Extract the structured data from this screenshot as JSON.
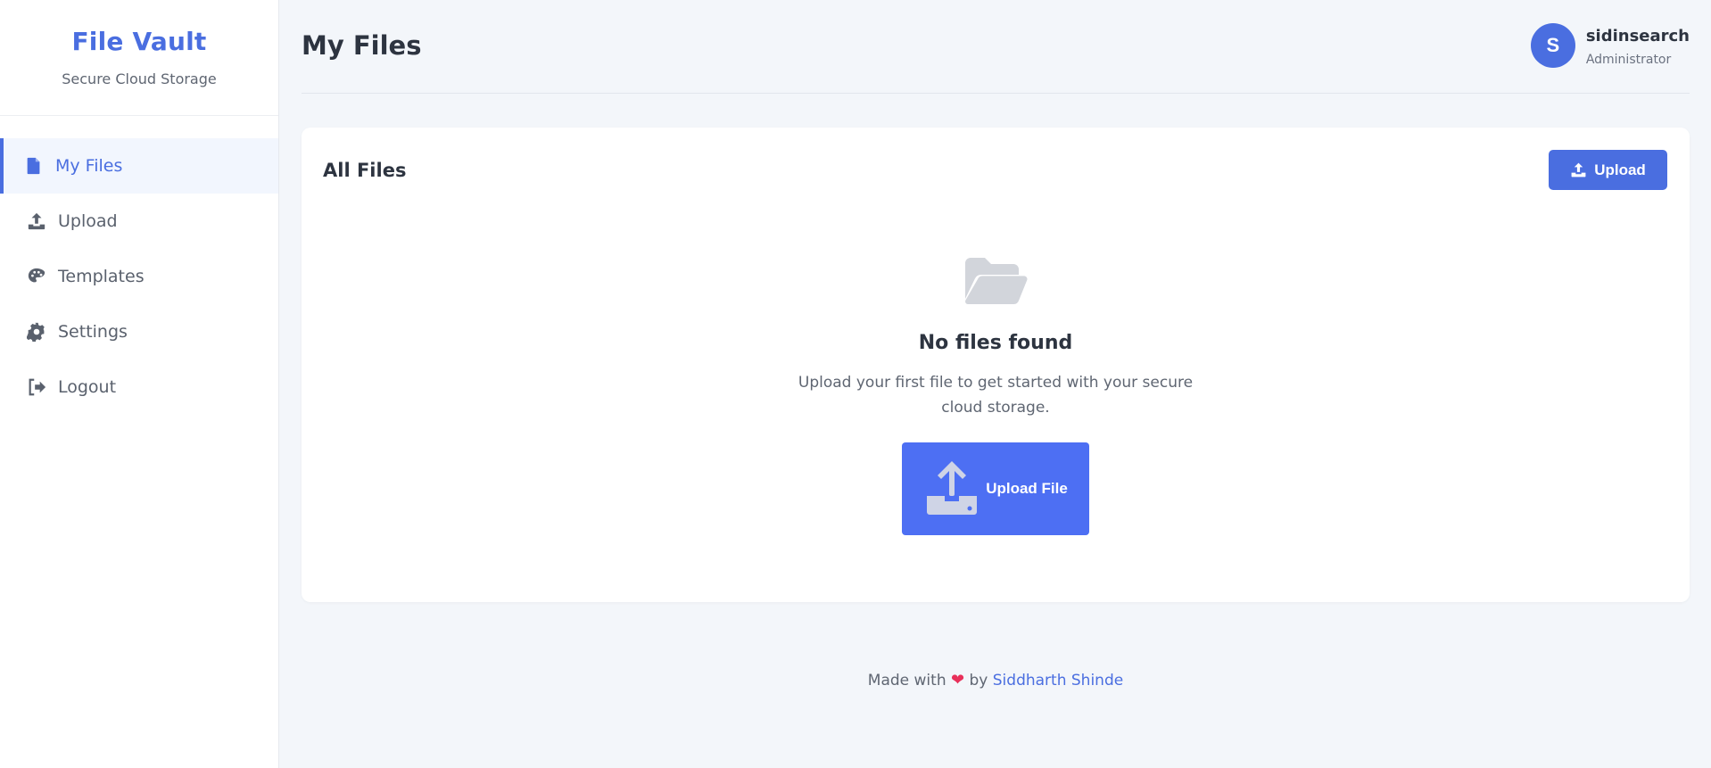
{
  "brand": {
    "title": "File Vault",
    "subtitle": "Secure Cloud Storage",
    "accent_color": "#4a6ee0"
  },
  "sidebar": {
    "items": [
      {
        "label": "My Files",
        "icon": "file-icon",
        "active": true
      },
      {
        "label": "Upload",
        "icon": "upload-icon",
        "active": false
      },
      {
        "label": "Templates",
        "icon": "palette-icon",
        "active": false
      },
      {
        "label": "Settings",
        "icon": "gear-icon",
        "active": false
      },
      {
        "label": "Logout",
        "icon": "logout-icon",
        "active": false
      }
    ]
  },
  "header": {
    "title": "My Files",
    "user": {
      "initial": "S",
      "name": "sidinsearch",
      "role": "Administrator"
    }
  },
  "main": {
    "card_title": "All Files",
    "upload_button_label": "Upload",
    "empty": {
      "icon": "folder-open-icon",
      "title": "No files found",
      "text": "Upload your first file to get started with your secure cloud storage.",
      "button_label": "Upload File"
    }
  },
  "footer": {
    "prefix": "Made with",
    "heart": "❤",
    "by": "by",
    "author": "Siddharth Shinde"
  }
}
